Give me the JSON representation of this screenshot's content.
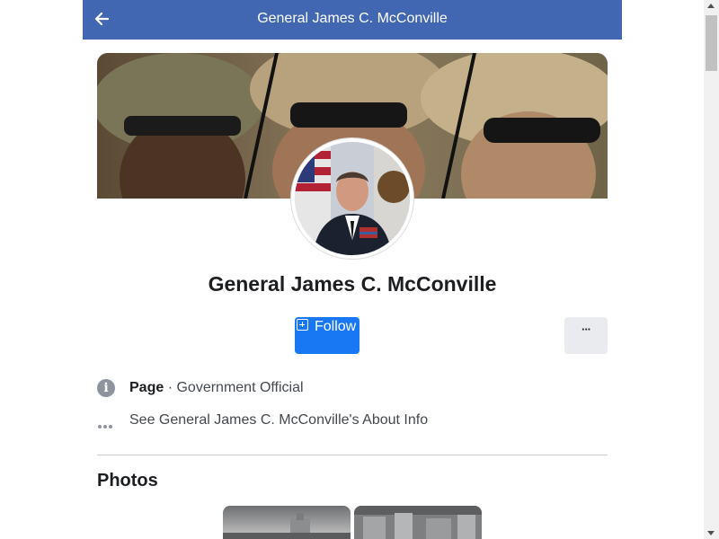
{
  "header": {
    "title": "General James C. McConville",
    "back_icon": "back-arrow-icon",
    "bg_color": "#4267b2"
  },
  "profile": {
    "name": "General James C. McConville",
    "follow_label": "Follow",
    "follow_icon": "follow-plus-icon",
    "more_label": "···",
    "accent_color": "#1877f2"
  },
  "about": {
    "category_label": "Page",
    "separator": " · ",
    "category_value": "Government Official",
    "about_link": "See General James C. McConville's About Info",
    "info_icon": "info-icon",
    "ellipsis_icon": "ellipsis-icon"
  },
  "photos": {
    "section_title": "Photos"
  }
}
